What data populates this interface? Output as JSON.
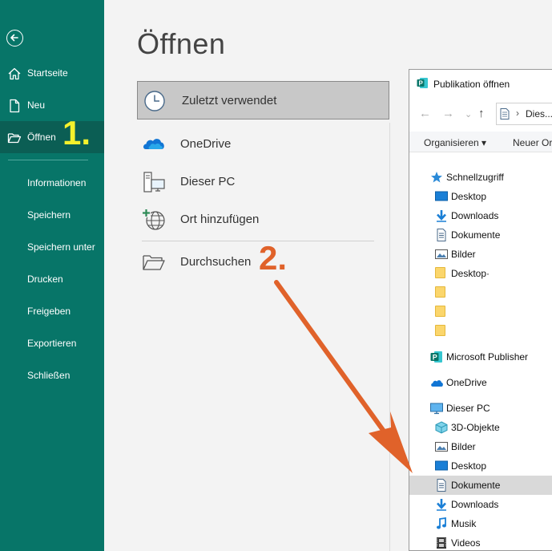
{
  "sidebar": {
    "back_icon": "arrow-left-circle-icon",
    "items": [
      {
        "label": "Startseite",
        "icon": "home-icon"
      },
      {
        "label": "Neu",
        "icon": "new-document-icon"
      },
      {
        "label": "Öffnen",
        "icon": "open-folder-icon"
      }
    ],
    "plain_items": [
      "Informationen",
      "Speichern",
      "Speichern unter",
      "Drucken",
      "Freigeben",
      "Exportieren",
      "Schließen"
    ],
    "step_marker": "1.",
    "colors": {
      "background": "#077568",
      "active": "#0b5e54",
      "step": "#f4f12c"
    }
  },
  "main": {
    "title": "Öffnen",
    "locations": [
      {
        "label": "Zuletzt verwendet",
        "icon": "clock-icon"
      },
      {
        "label": "OneDrive",
        "icon": "onedrive-cloud-icon"
      },
      {
        "label": "Dieser PC",
        "icon": "this-pc-icon"
      },
      {
        "label": "Ort hinzufügen",
        "icon": "add-location-globe-icon"
      },
      {
        "label": "Durchsuchen",
        "icon": "browse-folder-icon"
      }
    ],
    "step_marker": "2.",
    "step_color": "#e0622a"
  },
  "dialog": {
    "title": "Publikation öffnen",
    "address": "Dies...",
    "commands": {
      "organize": "Organisieren ▾",
      "new_folder": "Neuer Or"
    },
    "tree": [
      {
        "label": "Schnellzugriff",
        "icon": "star-icon"
      },
      {
        "label": "Desktop",
        "icon": "desktop-icon"
      },
      {
        "label": "Downloads",
        "icon": "download-arrow-icon"
      },
      {
        "label": "Dokumente",
        "icon": "document-icon"
      },
      {
        "label": "Bilder",
        "icon": "pictures-icon"
      },
      {
        "label": "Desktop·",
        "icon": "folder-icon"
      },
      {
        "label": "",
        "icon": "folder-icon"
      },
      {
        "label": "",
        "icon": "folder-icon"
      },
      {
        "label": "",
        "icon": "folder-icon"
      },
      {
        "label": "Microsoft Publisher",
        "icon": "publisher-icon"
      },
      {
        "label": "OneDrive",
        "icon": "onedrive-cloud-icon"
      },
      {
        "label": "Dieser PC",
        "icon": "this-pc-icon"
      },
      {
        "label": "3D-Objekte",
        "icon": "3d-objects-icon"
      },
      {
        "label": "Bilder",
        "icon": "pictures-icon"
      },
      {
        "label": "Desktop",
        "icon": "desktop-icon"
      },
      {
        "label": "Dokumente",
        "icon": "document-icon"
      },
      {
        "label": "Downloads",
        "icon": "download-arrow-icon"
      },
      {
        "label": "Musik",
        "icon": "music-note-icon"
      },
      {
        "label": "Videos",
        "icon": "video-film-icon"
      }
    ]
  }
}
